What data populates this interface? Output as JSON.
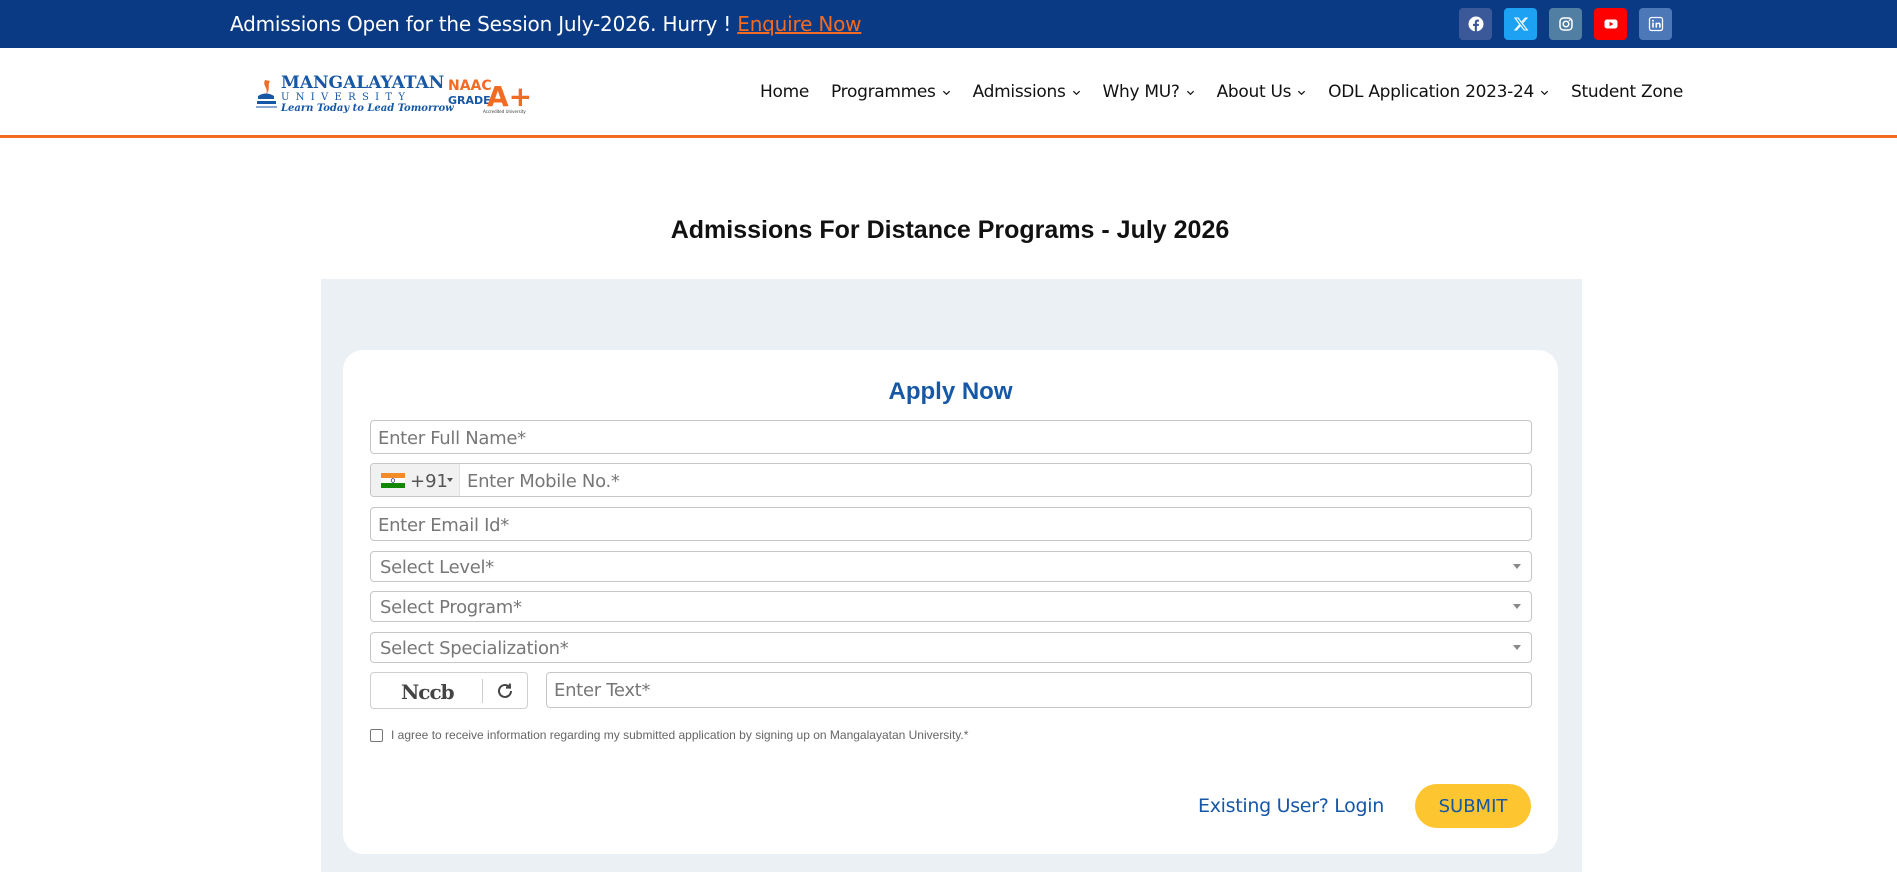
{
  "topbar": {
    "announcement": "Admissions Open for the Session July-2026. Hurry ! ",
    "enquire_link": "Enquire Now",
    "socials": [
      {
        "name": "facebook",
        "color": "#3b5998"
      },
      {
        "name": "x-twitter",
        "color": "#1da1f2"
      },
      {
        "name": "instagram",
        "color": "#517fa4"
      },
      {
        "name": "youtube",
        "color": "#ff0000"
      },
      {
        "name": "linkedin",
        "color": "#4c78b8"
      }
    ]
  },
  "logo": {
    "name_line1": "MANGALAYATAN",
    "name_line2": "UNIVERSITY",
    "tagline": "Learn Today to Lead Tomorrow",
    "badge_naac": "NAAC",
    "badge_grade": "GRADE",
    "badge_aplus": "A+",
    "badge_small": "Accredited University"
  },
  "nav": {
    "home": "Home",
    "programmes": "Programmes",
    "admissions": "Admissions",
    "why_mu": "Why MU?",
    "about_us": "About Us",
    "odl": "ODL Application 2023-24",
    "student_zone": "Student Zone"
  },
  "page_title": "Admissions For Distance Programs - July 2026",
  "form": {
    "title": "Apply Now",
    "full_name_placeholder": "Enter Full Name*",
    "dial_code": "+91",
    "mobile_placeholder": "Enter Mobile No.*",
    "email_placeholder": "Enter Email Id*",
    "level_select": "Select Level*",
    "program_select": "Select Program*",
    "specialization_select": "Select Specialization*",
    "captcha_code": "Nccb",
    "captcha_placeholder": "Enter Text*",
    "consent_text": "I agree to receive information regarding my submitted application by signing up on Mangalayatan University.*",
    "login_link": "Existing User? Login",
    "submit_label": "SUBMIT"
  },
  "colors": {
    "topbar_bg": "#0a3a84",
    "accent_orange": "#f26b22",
    "brand_blue": "#1657a6",
    "submit_yellow": "#fdc52f",
    "panel_bg": "#ebf0f4"
  }
}
